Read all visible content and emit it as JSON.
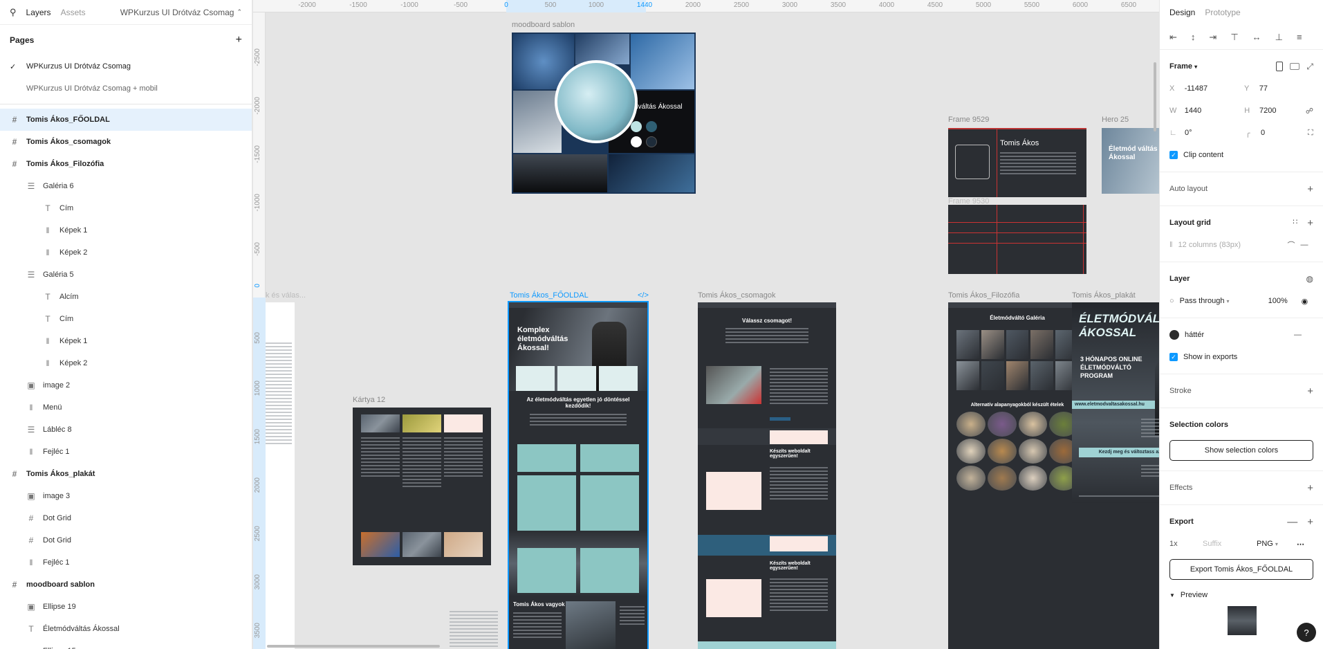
{
  "left_panel": {
    "tabs": [
      "Layers",
      "Assets"
    ],
    "file_name": "WPKurzus UI Drótváz Csomag",
    "pages_title": "Pages",
    "pages": [
      {
        "label": "WPKurzus UI Drótváz Csomag",
        "current": true
      },
      {
        "label": "WPKurzus UI Drótváz Csomag + mobil",
        "current": false
      }
    ],
    "layers": [
      {
        "label": "Tomis Ákos_FŐOLDAL",
        "icon": "frame-icon",
        "depth": 0,
        "top": true,
        "selected": true
      },
      {
        "label": "Tomis Ákos_csomagok",
        "icon": "frame-icon",
        "depth": 0,
        "top": true
      },
      {
        "label": "Tomis Ákos_Filozófia",
        "icon": "frame-icon",
        "depth": 0,
        "top": true
      },
      {
        "label": "Galéria 6",
        "icon": "autolayout-vertical-icon",
        "depth": 1
      },
      {
        "label": "Cím",
        "icon": "text-icon",
        "depth": 2
      },
      {
        "label": "Képek 1",
        "icon": "autolayout-horizontal-icon",
        "depth": 2
      },
      {
        "label": "Képek 2",
        "icon": "autolayout-horizontal-icon",
        "depth": 2
      },
      {
        "label": "Galéria 5",
        "icon": "autolayout-vertical-icon",
        "depth": 1
      },
      {
        "label": "Alcím",
        "icon": "text-icon",
        "depth": 2
      },
      {
        "label": "Cím",
        "icon": "text-icon",
        "depth": 2
      },
      {
        "label": "Képek 1",
        "icon": "autolayout-horizontal-icon",
        "depth": 2
      },
      {
        "label": "Képek 2",
        "icon": "autolayout-horizontal-icon",
        "depth": 2
      },
      {
        "label": "image 2",
        "icon": "image-icon",
        "depth": 1
      },
      {
        "label": "Menü",
        "icon": "autolayout-horizontal-icon",
        "depth": 1
      },
      {
        "label": "Lábléc 8",
        "icon": "autolayout-vertical-icon",
        "depth": 1
      },
      {
        "label": "Fejléc 1",
        "icon": "autolayout-horizontal-icon",
        "depth": 1
      },
      {
        "label": "Tomis Ákos_plakát",
        "icon": "frame-icon",
        "depth": 0,
        "top": true
      },
      {
        "label": "image 3",
        "icon": "image-icon",
        "depth": 1
      },
      {
        "label": "Dot Grid",
        "icon": "frame-icon",
        "depth": 1
      },
      {
        "label": "Dot Grid",
        "icon": "frame-icon",
        "depth": 1
      },
      {
        "label": "Fejléc 1",
        "icon": "autolayout-horizontal-icon",
        "depth": 1
      },
      {
        "label": "moodboard sablon",
        "icon": "frame-icon",
        "depth": 0,
        "top": true
      },
      {
        "label": "Ellipse 19",
        "icon": "image-icon",
        "depth": 1
      },
      {
        "label": "Életmódváltás Ákossal",
        "icon": "text-icon",
        "depth": 1
      },
      {
        "label": "Ellipse 15",
        "icon": "ellipse-icon",
        "depth": 1
      }
    ]
  },
  "canvas": {
    "ruler_top": [
      "-2000",
      "-1500",
      "-1000",
      "-500",
      "0",
      "500",
      "1000",
      "1440",
      "2000",
      "2500",
      "3000",
      "3500",
      "4000",
      "4500",
      "5000",
      "5500",
      "6000",
      "6500"
    ],
    "ruler_left": [
      "-2500",
      "-2000",
      "-1500",
      "-1000",
      "-500",
      "0",
      "500",
      "1000",
      "1500",
      "2000",
      "2500",
      "3000",
      "3500"
    ],
    "frames": {
      "moodboard": "moodboard sablon",
      "moodboard_title": "Életmódváltás Ákossal",
      "frame9529": "Frame 9529",
      "frame9530": "Frame 9530",
      "hero25": "Hero 25",
      "partial": "k és válas...",
      "kartya": "Kártya 12",
      "fooldal": "Tomis Ákos_FŐOLDAL",
      "csomagok": "Tomis Ákos_csomagok",
      "filozofia": "Tomis Ákos_Filozófia",
      "plakat": "Tomis Ákos_plakát"
    },
    "card_name": "Tomis Ákos",
    "fooldal_hero_title": "Komplex életmódváltás Ákossal!",
    "fooldal_section": "Az életmódváltás egyetlen jó döntéssel kezdődik!",
    "fooldal_about": "Tomis Ákos vagyok",
    "csomagok_heading": "Válassz csomagot!",
    "csomagok_cta1": "Készíts weboldalt egyszerűen!",
    "csomagok_cta2": "Készíts weboldalt egyszerűen!",
    "filozofia_heading": "Életmódváltó Galéria",
    "filozofia_sub": "Alternatív alapanyagokból készült ételek",
    "plakat_title1": "ÉLETMÓDVÁLTÁS",
    "plakat_title2": "ÁKOSSAL",
    "plakat_program": "3 HÓNAPOS ONLINE ÉLETMÓDVÁLTÓ PROGRAM",
    "plakat_url": "www.eletmodvaltasakossal.hu",
    "plakat_banner": "Kezdj meg és változtass az életeden!",
    "hero25_title": "Életmód váltás Ákossal"
  },
  "right_panel": {
    "tabs": [
      "Design",
      "Prototype"
    ],
    "frame_label": "Frame",
    "x_label": "X",
    "x": "-11487",
    "y_label": "Y",
    "y": "77",
    "w_label": "W",
    "w": "1440",
    "h_label": "H",
    "h": "7200",
    "rotation": "0°",
    "radius": "0",
    "clip_content": "Clip content",
    "auto_layout": "Auto layout",
    "layout_grid": "Layout grid",
    "grid_value": "12 columns (83px)",
    "layer": "Layer",
    "blend": "Pass through",
    "opacity": "100%",
    "fill_name": "háttér",
    "show_exports": "Show in exports",
    "stroke": "Stroke",
    "selection_colors": "Selection colors",
    "show_selection_colors": "Show selection colors",
    "effects": "Effects",
    "export": "Export",
    "export_scale": "1x",
    "export_suffix": "Suffix",
    "export_format": "PNG",
    "export_button": "Export Tomis Ákos_FŐOLDAL",
    "preview": "Preview"
  }
}
